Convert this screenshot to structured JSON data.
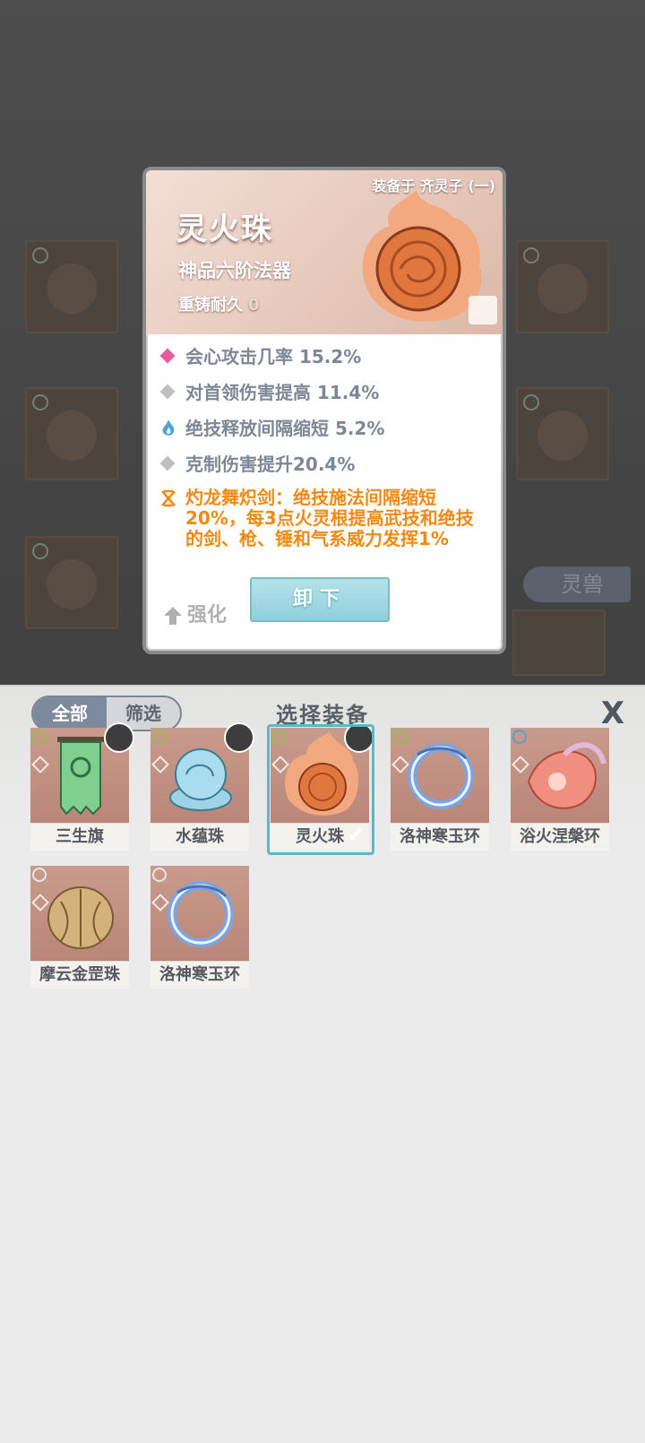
{
  "detail": {
    "equipped_on": "装备于 齐灵子 (一)",
    "name": "灵火珠",
    "grade": "神品六阶法器",
    "durability_label": "重铸耐久",
    "durability_value": "0",
    "stats": [
      {
        "text": "会心攻击几率 15.2%",
        "marker": "pink-diamond-icon",
        "color": "#e65c9b"
      },
      {
        "text": "对首领伤害提高 11.4%",
        "marker": "gray-diamond-icon",
        "color": "#bfbfbf"
      },
      {
        "text": "绝技释放间隔缩短 5.2%",
        "marker": "blue-flame-icon",
        "color": "#4fa3d6"
      },
      {
        "text": "克制伤害提升20.4%",
        "marker": "gray-diamond-icon",
        "color": "#bfbfbf"
      }
    ],
    "special": "灼龙舞炽剑：绝技施法间隔缩短20%，每3点火灵根提高武技和绝技的剑、枪、锤和气系威力发挥1%",
    "upgrade_label": "强化",
    "unequip_label": "卸下"
  },
  "background": {
    "beast_label": "灵兽"
  },
  "panel": {
    "tab_all": "全部",
    "tab_filter": "筛选",
    "title": "选择装备",
    "close_label": "X",
    "items": [
      {
        "name": "三生旗",
        "icon": "banner-icon",
        "has_avatar": true,
        "selected": false
      },
      {
        "name": "水蕴珠",
        "icon": "water-orb-icon",
        "has_avatar": true,
        "selected": false
      },
      {
        "name": "灵火珠",
        "icon": "fire-orb-icon",
        "has_avatar": true,
        "selected": true
      },
      {
        "name": "洛神寒玉环",
        "icon": "jade-ring-icon",
        "has_avatar": false,
        "selected": false
      },
      {
        "name": "浴火涅槃环",
        "icon": "phoenix-ring-icon",
        "has_avatar": false,
        "selected": false
      },
      {
        "name": "摩云金罡珠",
        "icon": "gold-orb-icon",
        "has_avatar": false,
        "selected": false
      },
      {
        "name": "洛神寒玉环",
        "icon": "jade-ring-icon",
        "has_avatar": false,
        "selected": false
      }
    ]
  },
  "colors": {
    "accent_teal": "#5fb6c9",
    "special_orange": "#f08a13",
    "stat_gray": "#7d8795"
  }
}
